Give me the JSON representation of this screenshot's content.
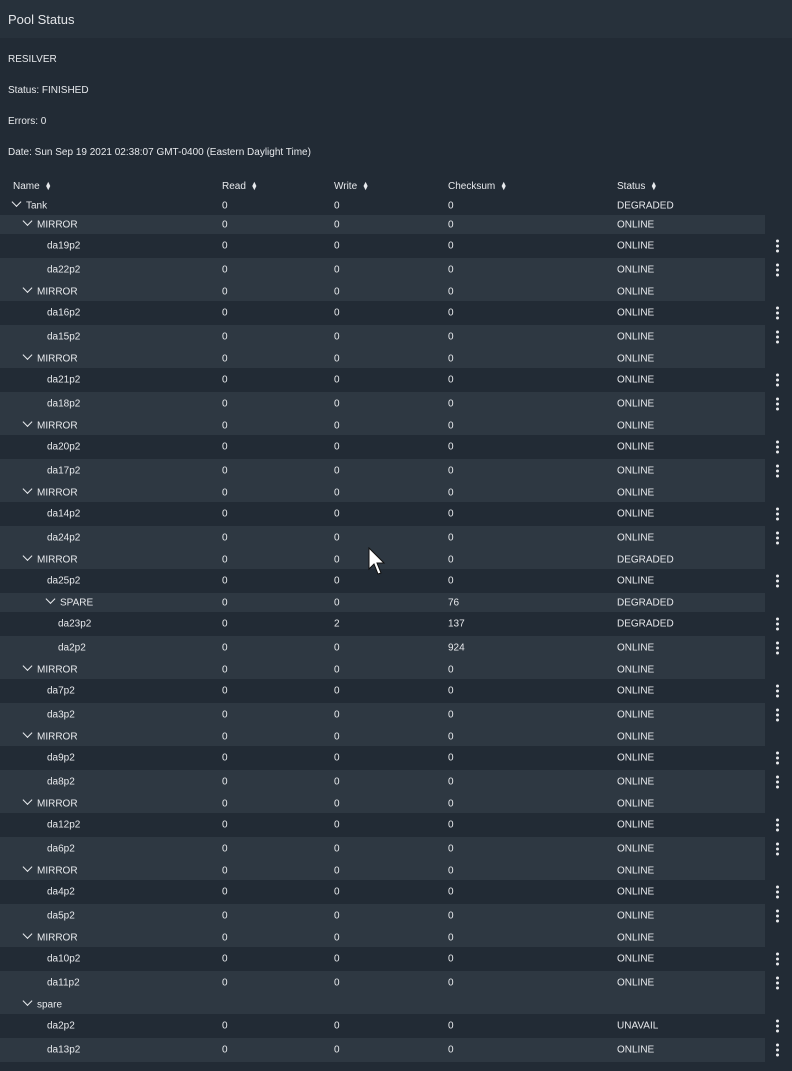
{
  "header": {
    "title": "Pool Status"
  },
  "info": {
    "type": "RESILVER",
    "status": "Status: FINISHED",
    "errors": "Errors: 0",
    "date": "Date: Sun Sep 19 2021 02:38:07 GMT-0400 (Eastern Daylight Time)"
  },
  "columns": [
    {
      "label": "Name",
      "name": "name-column-header"
    },
    {
      "label": "Read",
      "name": "read-column-header"
    },
    {
      "label": "Write",
      "name": "write-column-header"
    },
    {
      "label": "Checksum",
      "name": "checksum-column-header"
    },
    {
      "label": "Status",
      "name": "status-column-header"
    }
  ],
  "icons": {
    "expand": "chevron-down-icon",
    "menu": "more-vertical-icon",
    "sort": "sort-icon",
    "cursor": "mouse-cursor-icon"
  },
  "rows": [
    {
      "name": "Tank",
      "read": "0",
      "write": "0",
      "checksum": "0",
      "status": "DEGRADED",
      "level": 0,
      "kind": "group"
    },
    {
      "name": "MIRROR",
      "read": "0",
      "write": "0",
      "checksum": "0",
      "status": "ONLINE",
      "level": 1,
      "kind": "group"
    },
    {
      "name": "da19p2",
      "read": "0",
      "write": "0",
      "checksum": "0",
      "status": "ONLINE",
      "level": 2,
      "kind": "leaf"
    },
    {
      "name": "da22p2",
      "read": "0",
      "write": "0",
      "checksum": "0",
      "status": "ONLINE",
      "level": 2,
      "kind": "leaf"
    },
    {
      "name": "MIRROR",
      "read": "0",
      "write": "0",
      "checksum": "0",
      "status": "ONLINE",
      "level": 1,
      "kind": "group"
    },
    {
      "name": "da16p2",
      "read": "0",
      "write": "0",
      "checksum": "0",
      "status": "ONLINE",
      "level": 2,
      "kind": "leaf"
    },
    {
      "name": "da15p2",
      "read": "0",
      "write": "0",
      "checksum": "0",
      "status": "ONLINE",
      "level": 2,
      "kind": "leaf"
    },
    {
      "name": "MIRROR",
      "read": "0",
      "write": "0",
      "checksum": "0",
      "status": "ONLINE",
      "level": 1,
      "kind": "group"
    },
    {
      "name": "da21p2",
      "read": "0",
      "write": "0",
      "checksum": "0",
      "status": "ONLINE",
      "level": 2,
      "kind": "leaf"
    },
    {
      "name": "da18p2",
      "read": "0",
      "write": "0",
      "checksum": "0",
      "status": "ONLINE",
      "level": 2,
      "kind": "leaf"
    },
    {
      "name": "MIRROR",
      "read": "0",
      "write": "0",
      "checksum": "0",
      "status": "ONLINE",
      "level": 1,
      "kind": "group"
    },
    {
      "name": "da20p2",
      "read": "0",
      "write": "0",
      "checksum": "0",
      "status": "ONLINE",
      "level": 2,
      "kind": "leaf"
    },
    {
      "name": "da17p2",
      "read": "0",
      "write": "0",
      "checksum": "0",
      "status": "ONLINE",
      "level": 2,
      "kind": "leaf"
    },
    {
      "name": "MIRROR",
      "read": "0",
      "write": "0",
      "checksum": "0",
      "status": "ONLINE",
      "level": 1,
      "kind": "group"
    },
    {
      "name": "da14p2",
      "read": "0",
      "write": "0",
      "checksum": "0",
      "status": "ONLINE",
      "level": 2,
      "kind": "leaf"
    },
    {
      "name": "da24p2",
      "read": "0",
      "write": "0",
      "checksum": "0",
      "status": "ONLINE",
      "level": 2,
      "kind": "leaf"
    },
    {
      "name": "MIRROR",
      "read": "0",
      "write": "0",
      "checksum": "0",
      "status": "DEGRADED",
      "level": 1,
      "kind": "group"
    },
    {
      "name": "da25p2",
      "read": "0",
      "write": "0",
      "checksum": "0",
      "status": "ONLINE",
      "level": 2,
      "kind": "leaf"
    },
    {
      "name": "SPARE",
      "read": "0",
      "write": "0",
      "checksum": "76",
      "status": "DEGRADED",
      "level": 2,
      "kind": "group"
    },
    {
      "name": "da23p2",
      "read": "0",
      "write": "2",
      "checksum": "137",
      "status": "DEGRADED",
      "level": 3,
      "kind": "leaf"
    },
    {
      "name": "da2p2",
      "read": "0",
      "write": "0",
      "checksum": "924",
      "status": "ONLINE",
      "level": 3,
      "kind": "leaf"
    },
    {
      "name": "MIRROR",
      "read": "0",
      "write": "0",
      "checksum": "0",
      "status": "ONLINE",
      "level": 1,
      "kind": "group"
    },
    {
      "name": "da7p2",
      "read": "0",
      "write": "0",
      "checksum": "0",
      "status": "ONLINE",
      "level": 2,
      "kind": "leaf"
    },
    {
      "name": "da3p2",
      "read": "0",
      "write": "0",
      "checksum": "0",
      "status": "ONLINE",
      "level": 2,
      "kind": "leaf"
    },
    {
      "name": "MIRROR",
      "read": "0",
      "write": "0",
      "checksum": "0",
      "status": "ONLINE",
      "level": 1,
      "kind": "group"
    },
    {
      "name": "da9p2",
      "read": "0",
      "write": "0",
      "checksum": "0",
      "status": "ONLINE",
      "level": 2,
      "kind": "leaf"
    },
    {
      "name": "da8p2",
      "read": "0",
      "write": "0",
      "checksum": "0",
      "status": "ONLINE",
      "level": 2,
      "kind": "leaf"
    },
    {
      "name": "MIRROR",
      "read": "0",
      "write": "0",
      "checksum": "0",
      "status": "ONLINE",
      "level": 1,
      "kind": "group"
    },
    {
      "name": "da12p2",
      "read": "0",
      "write": "0",
      "checksum": "0",
      "status": "ONLINE",
      "level": 2,
      "kind": "leaf"
    },
    {
      "name": "da6p2",
      "read": "0",
      "write": "0",
      "checksum": "0",
      "status": "ONLINE",
      "level": 2,
      "kind": "leaf"
    },
    {
      "name": "MIRROR",
      "read": "0",
      "write": "0",
      "checksum": "0",
      "status": "ONLINE",
      "level": 1,
      "kind": "group"
    },
    {
      "name": "da4p2",
      "read": "0",
      "write": "0",
      "checksum": "0",
      "status": "ONLINE",
      "level": 2,
      "kind": "leaf"
    },
    {
      "name": "da5p2",
      "read": "0",
      "write": "0",
      "checksum": "0",
      "status": "ONLINE",
      "level": 2,
      "kind": "leaf"
    },
    {
      "name": "MIRROR",
      "read": "0",
      "write": "0",
      "checksum": "0",
      "status": "ONLINE",
      "level": 1,
      "kind": "group"
    },
    {
      "name": "da10p2",
      "read": "0",
      "write": "0",
      "checksum": "0",
      "status": "ONLINE",
      "level": 2,
      "kind": "leaf"
    },
    {
      "name": "da11p2",
      "read": "0",
      "write": "0",
      "checksum": "0",
      "status": "ONLINE",
      "level": 2,
      "kind": "leaf"
    },
    {
      "name": "spare",
      "read": "",
      "write": "",
      "checksum": "",
      "status": "",
      "level": 1,
      "kind": "group"
    },
    {
      "name": "da2p2",
      "read": "0",
      "write": "0",
      "checksum": "0",
      "status": "UNAVAIL",
      "level": 2,
      "kind": "leaf"
    },
    {
      "name": "da13p2",
      "read": "0",
      "write": "0",
      "checksum": "0",
      "status": "ONLINE",
      "level": 2,
      "kind": "leaf"
    }
  ]
}
